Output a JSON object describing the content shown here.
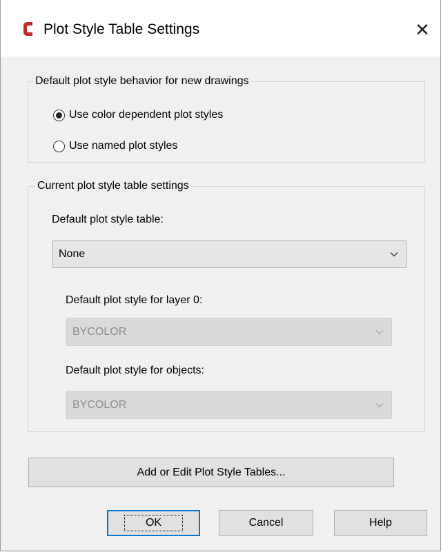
{
  "window": {
    "title": "Plot Style Table Settings",
    "close_glyph": "✕",
    "app_icon": "autocad-logo-icon",
    "accent_color": "#c62828"
  },
  "behavior_group": {
    "legend": "Default plot style behavior for new drawings",
    "options": [
      {
        "label": "Use color dependent plot styles",
        "selected": true
      },
      {
        "label": "Use named plot styles",
        "selected": false
      }
    ]
  },
  "table_group": {
    "legend": "Current plot style table settings",
    "default_table_label": "Default plot style table:",
    "default_table_value": "None",
    "layer0_label": "Default plot style for layer 0:",
    "layer0_value": "BYCOLOR",
    "objects_label": "Default plot style for objects:",
    "objects_value": "BYCOLOR"
  },
  "buttons": {
    "add_edit": "Add or Edit Plot Style Tables...",
    "ok": "OK",
    "cancel": "Cancel",
    "help": "Help"
  }
}
